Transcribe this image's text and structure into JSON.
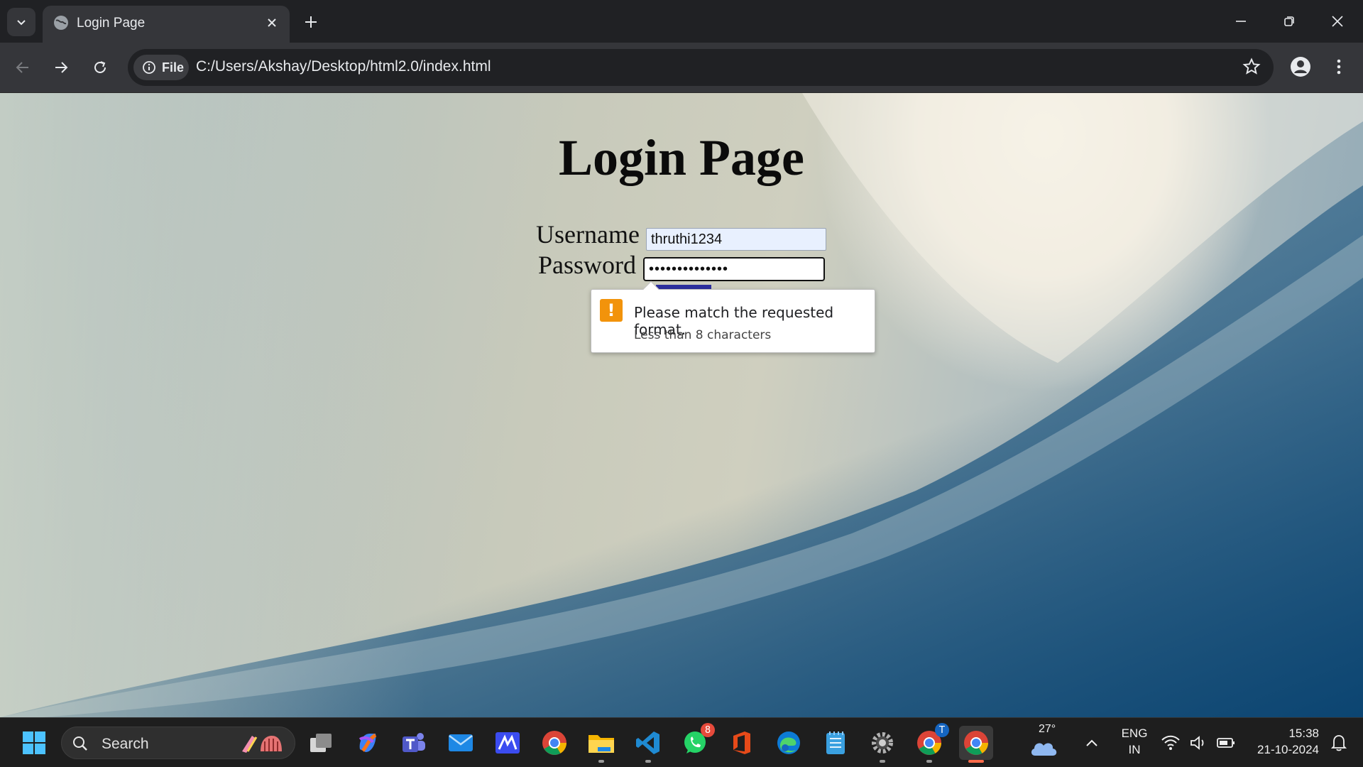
{
  "browser": {
    "tab_title": "Login Page",
    "address_chip": "File",
    "url": "C:/Users/Akshay/Desktop/html2.0/index.html"
  },
  "page": {
    "title": "Login Page",
    "username_label": "Username",
    "username_value": "thruthi1234",
    "password_label": "Password",
    "password_value": "••••••••••••••"
  },
  "validation": {
    "message": "Please match the requested format.",
    "detail": "Less than 8 characters",
    "icon": "warning-icon",
    "icon_color": "#f2930b"
  },
  "taskbar": {
    "search_label": "Search",
    "whatsapp_badge": "8",
    "chrome_profile_badge": "T",
    "weather_temp": "27°",
    "language_line1": "ENG",
    "language_line2": "IN",
    "time": "15:38",
    "date": "21-10-2024"
  },
  "colors": {
    "chrome_dark": "#202124",
    "toolbar": "#35363a",
    "taskbar": "#1e1e1e",
    "active_indicator": "#ff6b4a"
  }
}
